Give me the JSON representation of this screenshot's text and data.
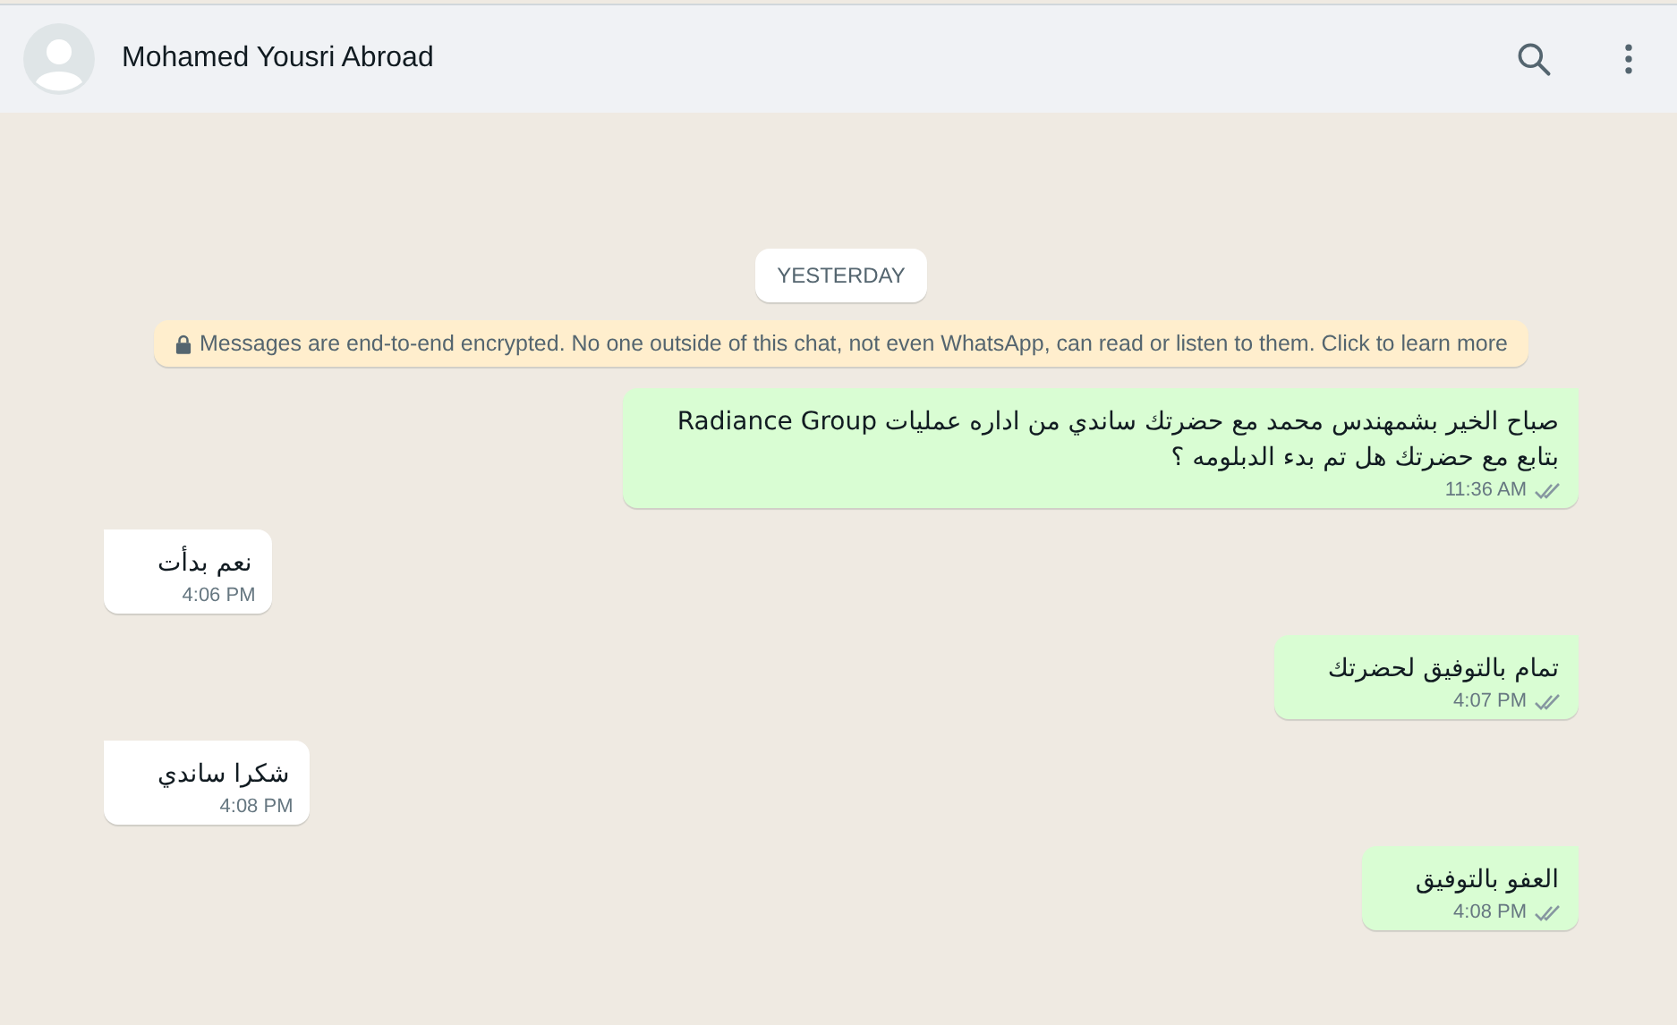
{
  "header": {
    "contact_name": "Mohamed Yousri Abroad"
  },
  "date_chip": "YESTERDAY",
  "encryption_notice": "Messages are end-to-end encrypted. No one outside of this chat, not even WhatsApp, can read or listen to them. Click to learn more",
  "messages": [
    {
      "kind": "outgoing",
      "text": "صباح الخير بشمهندس محمد مع حضرتك ساندي من اداره عمليات Radiance Group\nبتابع مع حضرتك هل تم بدء الدبلومه ؟",
      "time": "11:36 AM",
      "read": false
    },
    {
      "kind": "incoming",
      "text": "نعم بدأت",
      "time": "4:06 PM"
    },
    {
      "kind": "outgoing",
      "text": "تمام بالتوفيق لحضرتك",
      "time": "4:07 PM",
      "read": false
    },
    {
      "kind": "incoming",
      "text": "شكرا ساندي",
      "time": "4:08 PM"
    },
    {
      "kind": "outgoing",
      "text": "العفو بالتوفيق",
      "time": "4:08 PM",
      "read": false
    }
  ]
}
